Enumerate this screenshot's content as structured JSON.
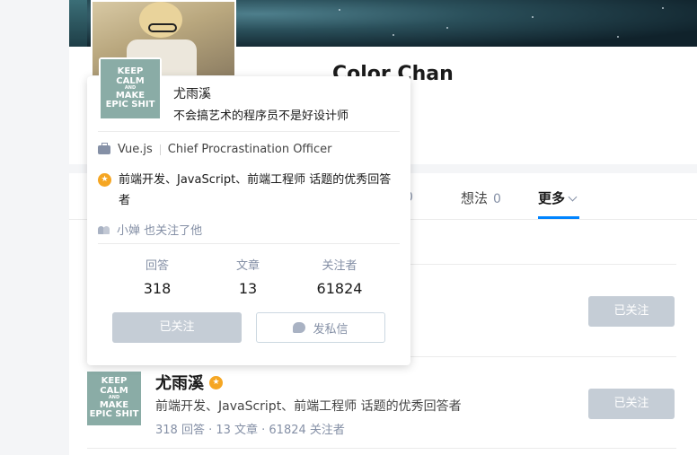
{
  "profile": {
    "name": "Color Chan"
  },
  "tabs": [
    {
      "label": "",
      "count": "0"
    },
    {
      "label": "想法",
      "count": "0"
    },
    {
      "label": "更多",
      "count": ""
    }
  ],
  "follow_buttons": {
    "label": "已关注"
  },
  "list_user": {
    "name": "尤雨溪",
    "honor": "前端开发、JavaScript、前端工程师 话题的优秀回答者",
    "stats": "318 回答 · 13 文章 · 61824 关注者"
  },
  "avatar_text": {
    "line1": "KEEP",
    "line2": "CALM",
    "line3": "AND",
    "line4": "MAKE",
    "line5": "EPIC SHIT"
  },
  "popup": {
    "name": "尤雨溪",
    "headline": "不会搞艺术的程序员不是好设计师",
    "company": "Vue.js",
    "position": "Chief Procrastination Officer",
    "honor": "前端开发、JavaScript、前端工程师 话题的优秀回答者",
    "mutual": "小婵 也关注了他",
    "stats": [
      {
        "label": "回答",
        "value": "318"
      },
      {
        "label": "文章",
        "value": "13"
      },
      {
        "label": "关注者",
        "value": "61824"
      }
    ],
    "followed_label": "已关注",
    "message_label": "发私信"
  },
  "colors": {
    "accent": "#0084ff",
    "badge": "#f5a623",
    "followed_button": "#c5cdd6",
    "avatar_bg": "#8aaca6"
  },
  "icons": [
    "briefcase-icon",
    "star-badge-icon",
    "people-icon",
    "chat-icon",
    "chevron-down-icon"
  ]
}
